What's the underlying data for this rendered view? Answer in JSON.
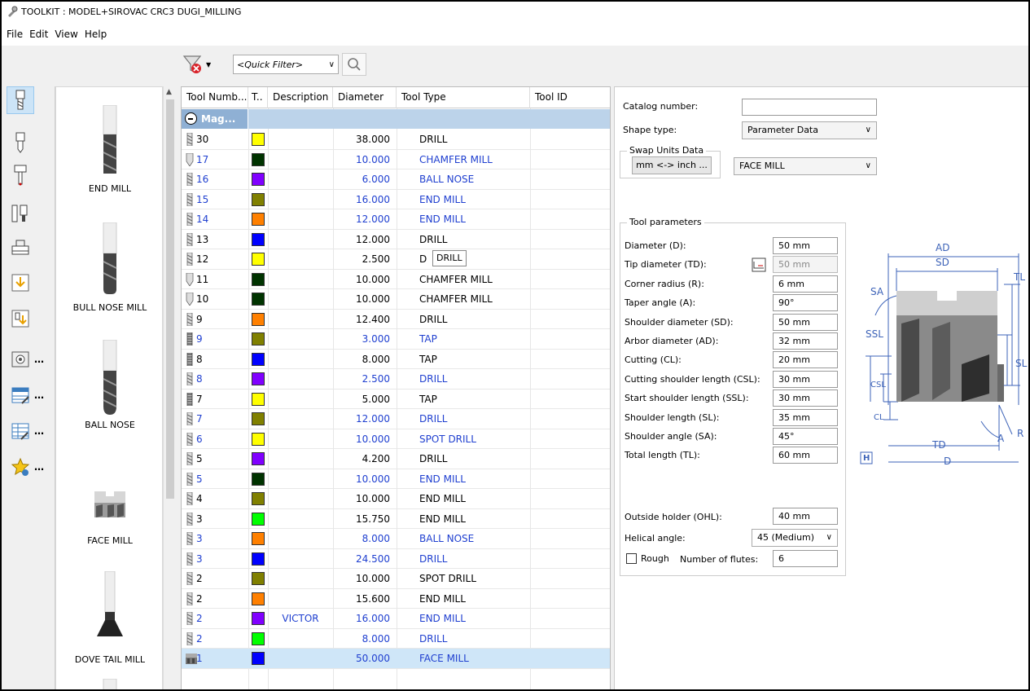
{
  "window": {
    "title": "TOOLKIT : MODEL+SIROVAC CRC3 DUGI_MILLING"
  },
  "menu": [
    "File",
    "Edit",
    "View",
    "Help"
  ],
  "toolbar": {
    "quick_filter_placeholder": "<Quick Filter>"
  },
  "shapes": [
    "END MILL",
    "BULL NOSE MILL",
    "BALL NOSE",
    "FACE MILL",
    "DOVE TAIL MILL"
  ],
  "grid": {
    "headers": [
      "Tool Numb...",
      "T..",
      "Description",
      "Diameter",
      "Tool Type",
      "Tool ID"
    ],
    "group_label": "Mag...",
    "rows": [
      {
        "num": "30",
        "color": "#ffff00",
        "desc": "",
        "dia": "38.000",
        "type": "DRILL",
        "blue": false,
        "icon": "drill"
      },
      {
        "num": "17",
        "color": "#003300",
        "desc": "",
        "dia": "10.000",
        "type": "CHAMFER MILL",
        "blue": true,
        "icon": "chamfer"
      },
      {
        "num": "16",
        "color": "#8000ff",
        "desc": "",
        "dia": "6.000",
        "type": "BALL NOSE",
        "blue": true,
        "icon": "drill"
      },
      {
        "num": "15",
        "color": "#808000",
        "desc": "",
        "dia": "16.000",
        "type": "END MILL",
        "blue": true,
        "icon": "drill"
      },
      {
        "num": "14",
        "color": "#ff8000",
        "desc": "",
        "dia": "12.000",
        "type": "END MILL",
        "blue": true,
        "icon": "drill"
      },
      {
        "num": "13",
        "color": "#0000ff",
        "desc": "",
        "dia": "12.000",
        "type": "DRILL",
        "blue": false,
        "icon": "drill"
      },
      {
        "num": "12",
        "color": "#ffff00",
        "desc": "",
        "dia": "2.500",
        "type": "D",
        "blue": false,
        "icon": "drill"
      },
      {
        "num": "11",
        "color": "#003300",
        "desc": "",
        "dia": "10.000",
        "type": "CHAMFER MILL",
        "blue": false,
        "icon": "chamfer"
      },
      {
        "num": "10",
        "color": "#003300",
        "desc": "",
        "dia": "10.000",
        "type": "CHAMFER MILL",
        "blue": false,
        "icon": "chamfer"
      },
      {
        "num": "9",
        "color": "#ff8000",
        "desc": "",
        "dia": "12.400",
        "type": "DRILL",
        "blue": false,
        "icon": "drill"
      },
      {
        "num": "9",
        "color": "#808000",
        "desc": "",
        "dia": "3.000",
        "type": "TAP",
        "blue": true,
        "icon": "tap"
      },
      {
        "num": "8",
        "color": "#0000ff",
        "desc": "",
        "dia": "8.000",
        "type": "TAP",
        "blue": false,
        "icon": "tap"
      },
      {
        "num": "8",
        "color": "#8000ff",
        "desc": "",
        "dia": "2.500",
        "type": "DRILL",
        "blue": true,
        "icon": "drill"
      },
      {
        "num": "7",
        "color": "#ffff00",
        "desc": "",
        "dia": "5.000",
        "type": "TAP",
        "blue": false,
        "icon": "tap"
      },
      {
        "num": "7",
        "color": "#808000",
        "desc": "",
        "dia": "12.000",
        "type": "DRILL",
        "blue": true,
        "icon": "drill"
      },
      {
        "num": "6",
        "color": "#ffff00",
        "desc": "",
        "dia": "10.000",
        "type": "SPOT DRILL",
        "blue": true,
        "icon": "drill"
      },
      {
        "num": "5",
        "color": "#8000ff",
        "desc": "",
        "dia": "4.200",
        "type": "DRILL",
        "blue": false,
        "icon": "drill"
      },
      {
        "num": "5",
        "color": "#003300",
        "desc": "",
        "dia": "10.000",
        "type": "END MILL",
        "blue": true,
        "icon": "drill"
      },
      {
        "num": "4",
        "color": "#808000",
        "desc": "",
        "dia": "10.000",
        "type": "END MILL",
        "blue": false,
        "icon": "drill"
      },
      {
        "num": "3",
        "color": "#00ff00",
        "desc": "",
        "dia": "15.750",
        "type": "END MILL",
        "blue": false,
        "icon": "drill"
      },
      {
        "num": "3",
        "color": "#ff8000",
        "desc": "",
        "dia": "8.000",
        "type": "BALL NOSE",
        "blue": true,
        "icon": "drill"
      },
      {
        "num": "3",
        "color": "#0000ff",
        "desc": "",
        "dia": "24.500",
        "type": "DRILL",
        "blue": true,
        "icon": "drill"
      },
      {
        "num": "2",
        "color": "#808000",
        "desc": "",
        "dia": "10.000",
        "type": "SPOT DRILL",
        "blue": false,
        "icon": "drill"
      },
      {
        "num": "2",
        "color": "#ff8000",
        "desc": "",
        "dia": "15.600",
        "type": "END MILL",
        "blue": false,
        "icon": "drill"
      },
      {
        "num": "2",
        "color": "#8000ff",
        "desc": "VICTOR",
        "dia": "16.000",
        "type": "END MILL",
        "blue": true,
        "icon": "drill"
      },
      {
        "num": "2",
        "color": "#00ff00",
        "desc": "",
        "dia": "8.000",
        "type": "DRILL",
        "blue": true,
        "icon": "drill"
      },
      {
        "num": "1",
        "color": "#0000ff",
        "desc": "",
        "dia": "50.000",
        "type": "FACE MILL",
        "blue": true,
        "icon": "face",
        "selected": true
      }
    ],
    "tooltip": "DRILL"
  },
  "panel": {
    "catalog_label": "Catalog number:",
    "catalog_value": "",
    "shape_type_label": "Shape type:",
    "shape_type_value": "Parameter Data",
    "swap_units_title": "Swap Units Data",
    "swap_button": "mm <-> inch ...",
    "tool_type_value": "FACE MILL",
    "params_title": "Tool parameters",
    "params": [
      {
        "label": "Diameter (D):",
        "value": "50 mm"
      },
      {
        "label": "Tip diameter (TD):",
        "value": "50 mm"
      },
      {
        "label": "Corner radius (R):",
        "value": "6 mm"
      },
      {
        "label": "Taper angle (A):",
        "value": "90°"
      },
      {
        "label": "Shoulder diameter (SD):",
        "value": "50 mm"
      },
      {
        "label": "Arbor diameter (AD):",
        "value": "32 mm"
      },
      {
        "label": "Cutting (CL):",
        "value": "20 mm"
      },
      {
        "label": "Cutting shoulder length (CSL):",
        "value": "30 mm"
      },
      {
        "label": "Start shoulder length (SSL):",
        "value": "30 mm"
      },
      {
        "label": "Shoulder length (SL):",
        "value": "35 mm"
      },
      {
        "label": "Shoulder angle (SA):",
        "value": "45°"
      },
      {
        "label": "Total length (TL):",
        "value": "60 mm"
      }
    ],
    "ohl_label": "Outside holder (OHL):",
    "ohl_value": "40 mm",
    "helical_label": "Helical angle:",
    "helical_value": "45 (Medium)",
    "rough_label": "Rough",
    "flutes_label": "Number of flutes:",
    "flutes_value": "6",
    "diagram_labels": {
      "ad": "AD",
      "sd": "SD",
      "tl": "TL",
      "sa": "SA",
      "ssl": "SSL",
      "sl": "SL",
      "csl": "CSL",
      "cl": "CL",
      "a": "A",
      "r": "R",
      "td": "TD",
      "d": "D",
      "h": "H"
    }
  }
}
